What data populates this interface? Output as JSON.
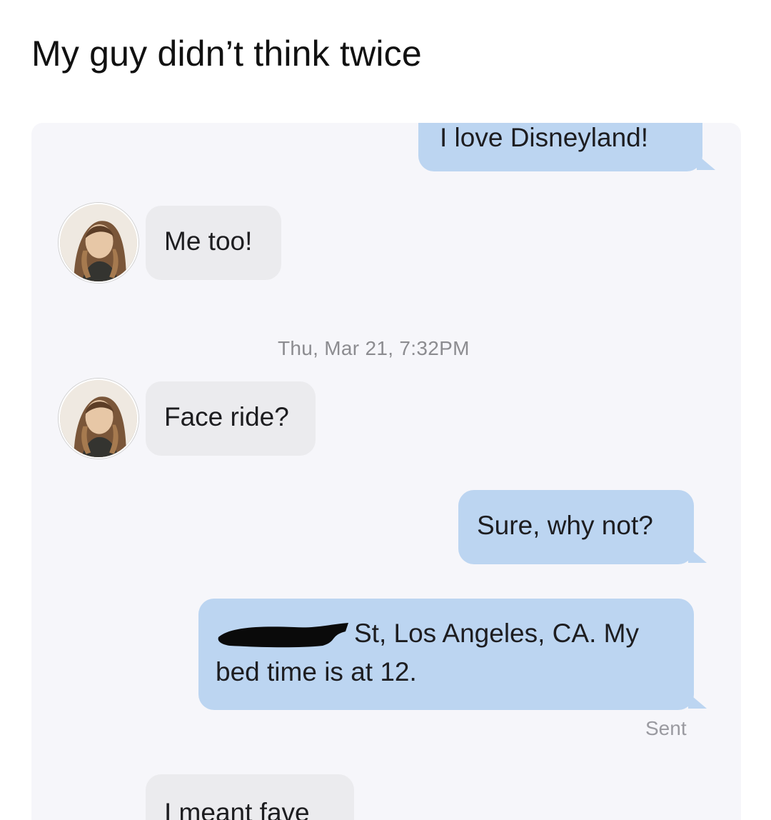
{
  "caption": "My guy didn’t think twice",
  "messages": {
    "m1": "I love Disneyland!",
    "m2": "Me too!",
    "timestamp": "Thu, Mar 21, 7:32PM",
    "m3": "Face ride?",
    "m4": "Sure, why not?",
    "m5_line1": "St, Los Angeles, CA. My",
    "m5_line2": "bed time is at 12.",
    "status": "Sent",
    "m6": "I meant fave"
  },
  "colors": {
    "outgoing_bubble": "#bcd5f1",
    "incoming_bubble": "#ebebee",
    "thread_background": "#f6f6fa"
  },
  "icons": [
    "contact-avatar",
    "redaction-scribble"
  ]
}
